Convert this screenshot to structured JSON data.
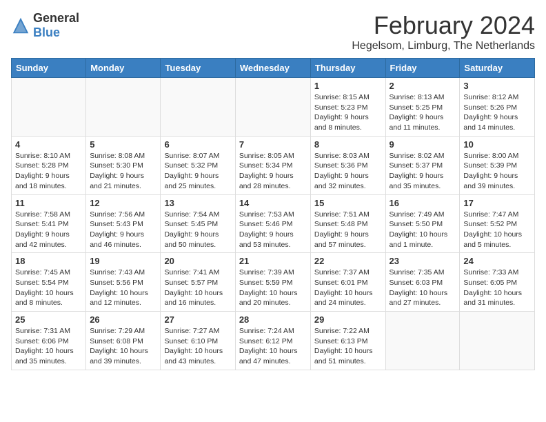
{
  "header": {
    "logo_general": "General",
    "logo_blue": "Blue",
    "month_title": "February 2024",
    "location": "Hegelsom, Limburg, The Netherlands"
  },
  "days_of_week": [
    "Sunday",
    "Monday",
    "Tuesday",
    "Wednesday",
    "Thursday",
    "Friday",
    "Saturday"
  ],
  "weeks": [
    [
      {
        "day": "",
        "info": ""
      },
      {
        "day": "",
        "info": ""
      },
      {
        "day": "",
        "info": ""
      },
      {
        "day": "",
        "info": ""
      },
      {
        "day": "1",
        "info": "Sunrise: 8:15 AM\nSunset: 5:23 PM\nDaylight: 9 hours\nand 8 minutes."
      },
      {
        "day": "2",
        "info": "Sunrise: 8:13 AM\nSunset: 5:25 PM\nDaylight: 9 hours\nand 11 minutes."
      },
      {
        "day": "3",
        "info": "Sunrise: 8:12 AM\nSunset: 5:26 PM\nDaylight: 9 hours\nand 14 minutes."
      }
    ],
    [
      {
        "day": "4",
        "info": "Sunrise: 8:10 AM\nSunset: 5:28 PM\nDaylight: 9 hours\nand 18 minutes."
      },
      {
        "day": "5",
        "info": "Sunrise: 8:08 AM\nSunset: 5:30 PM\nDaylight: 9 hours\nand 21 minutes."
      },
      {
        "day": "6",
        "info": "Sunrise: 8:07 AM\nSunset: 5:32 PM\nDaylight: 9 hours\nand 25 minutes."
      },
      {
        "day": "7",
        "info": "Sunrise: 8:05 AM\nSunset: 5:34 PM\nDaylight: 9 hours\nand 28 minutes."
      },
      {
        "day": "8",
        "info": "Sunrise: 8:03 AM\nSunset: 5:36 PM\nDaylight: 9 hours\nand 32 minutes."
      },
      {
        "day": "9",
        "info": "Sunrise: 8:02 AM\nSunset: 5:37 PM\nDaylight: 9 hours\nand 35 minutes."
      },
      {
        "day": "10",
        "info": "Sunrise: 8:00 AM\nSunset: 5:39 PM\nDaylight: 9 hours\nand 39 minutes."
      }
    ],
    [
      {
        "day": "11",
        "info": "Sunrise: 7:58 AM\nSunset: 5:41 PM\nDaylight: 9 hours\nand 42 minutes."
      },
      {
        "day": "12",
        "info": "Sunrise: 7:56 AM\nSunset: 5:43 PM\nDaylight: 9 hours\nand 46 minutes."
      },
      {
        "day": "13",
        "info": "Sunrise: 7:54 AM\nSunset: 5:45 PM\nDaylight: 9 hours\nand 50 minutes."
      },
      {
        "day": "14",
        "info": "Sunrise: 7:53 AM\nSunset: 5:46 PM\nDaylight: 9 hours\nand 53 minutes."
      },
      {
        "day": "15",
        "info": "Sunrise: 7:51 AM\nSunset: 5:48 PM\nDaylight: 9 hours\nand 57 minutes."
      },
      {
        "day": "16",
        "info": "Sunrise: 7:49 AM\nSunset: 5:50 PM\nDaylight: 10 hours\nand 1 minute."
      },
      {
        "day": "17",
        "info": "Sunrise: 7:47 AM\nSunset: 5:52 PM\nDaylight: 10 hours\nand 5 minutes."
      }
    ],
    [
      {
        "day": "18",
        "info": "Sunrise: 7:45 AM\nSunset: 5:54 PM\nDaylight: 10 hours\nand 8 minutes."
      },
      {
        "day": "19",
        "info": "Sunrise: 7:43 AM\nSunset: 5:56 PM\nDaylight: 10 hours\nand 12 minutes."
      },
      {
        "day": "20",
        "info": "Sunrise: 7:41 AM\nSunset: 5:57 PM\nDaylight: 10 hours\nand 16 minutes."
      },
      {
        "day": "21",
        "info": "Sunrise: 7:39 AM\nSunset: 5:59 PM\nDaylight: 10 hours\nand 20 minutes."
      },
      {
        "day": "22",
        "info": "Sunrise: 7:37 AM\nSunset: 6:01 PM\nDaylight: 10 hours\nand 24 minutes."
      },
      {
        "day": "23",
        "info": "Sunrise: 7:35 AM\nSunset: 6:03 PM\nDaylight: 10 hours\nand 27 minutes."
      },
      {
        "day": "24",
        "info": "Sunrise: 7:33 AM\nSunset: 6:05 PM\nDaylight: 10 hours\nand 31 minutes."
      }
    ],
    [
      {
        "day": "25",
        "info": "Sunrise: 7:31 AM\nSunset: 6:06 PM\nDaylight: 10 hours\nand 35 minutes."
      },
      {
        "day": "26",
        "info": "Sunrise: 7:29 AM\nSunset: 6:08 PM\nDaylight: 10 hours\nand 39 minutes."
      },
      {
        "day": "27",
        "info": "Sunrise: 7:27 AM\nSunset: 6:10 PM\nDaylight: 10 hours\nand 43 minutes."
      },
      {
        "day": "28",
        "info": "Sunrise: 7:24 AM\nSunset: 6:12 PM\nDaylight: 10 hours\nand 47 minutes."
      },
      {
        "day": "29",
        "info": "Sunrise: 7:22 AM\nSunset: 6:13 PM\nDaylight: 10 hours\nand 51 minutes."
      },
      {
        "day": "",
        "info": ""
      },
      {
        "day": "",
        "info": ""
      }
    ]
  ]
}
